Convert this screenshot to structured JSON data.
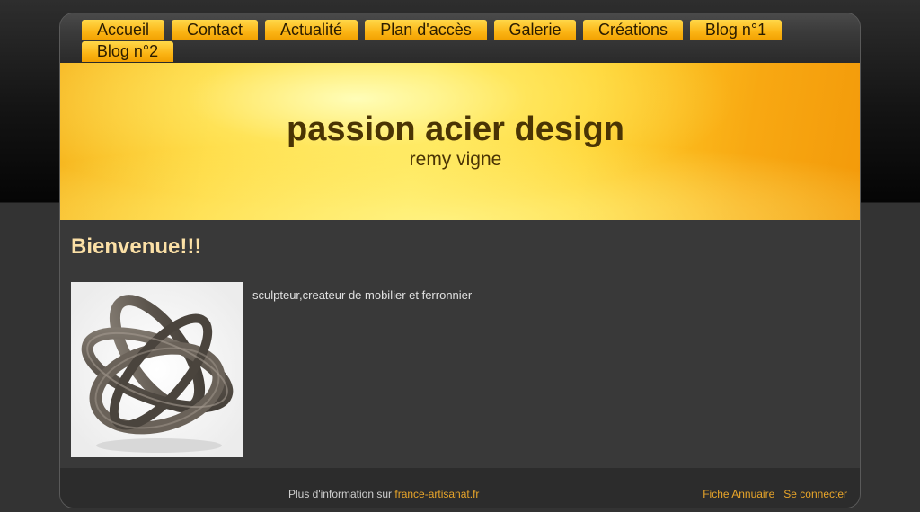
{
  "nav": {
    "items": [
      {
        "label": "Accueil"
      },
      {
        "label": "Contact"
      },
      {
        "label": "Actualité"
      },
      {
        "label": "Plan d'accès"
      },
      {
        "label": "Galerie"
      },
      {
        "label": "Créations"
      },
      {
        "label": "Blog n°1"
      },
      {
        "label": "Blog n°2"
      }
    ]
  },
  "header": {
    "title": "passion acier design",
    "subtitle": "remy vigne"
  },
  "content": {
    "heading": "Bienvenue!!!",
    "description": "sculpteur,createur de mobilier et ferronnier"
  },
  "footer": {
    "info_prefix": "Plus d'information sur",
    "info_link": "france-artisanat.fr",
    "annuaire_link": "Fiche Annuaire",
    "login_link": "Se connecter"
  },
  "colors": {
    "accent": "#fbb414",
    "heading": "#fbe0a6",
    "link": "#e8a52a"
  }
}
